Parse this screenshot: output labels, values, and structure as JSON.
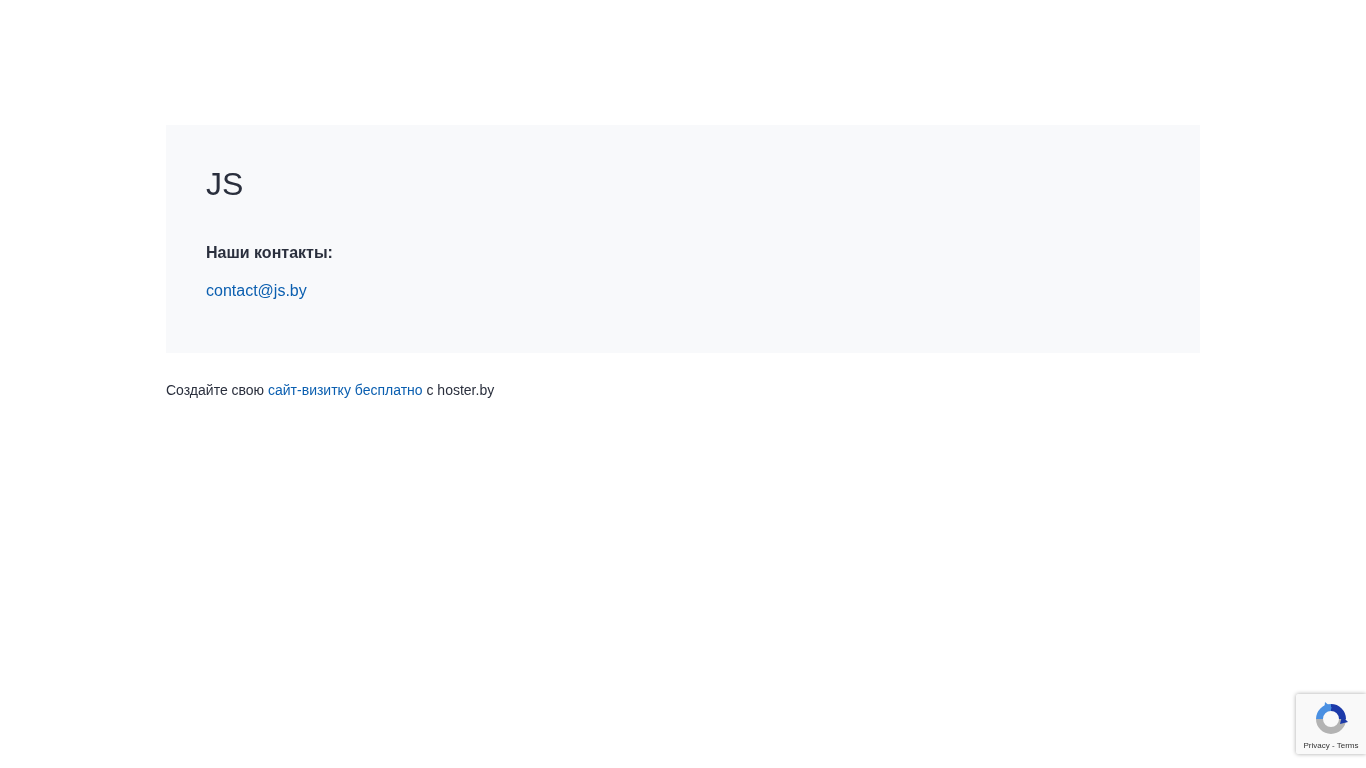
{
  "card": {
    "title": "JS",
    "contacts_heading": "Наши контакты:",
    "email": "contact@js.by"
  },
  "footer": {
    "prefix": "Создайте свою",
    "link": "сайт-визитку бесплатно",
    "suffix": "с hoster.by"
  },
  "recaptcha_badge": {
    "links": "Privacy - Terms"
  }
}
